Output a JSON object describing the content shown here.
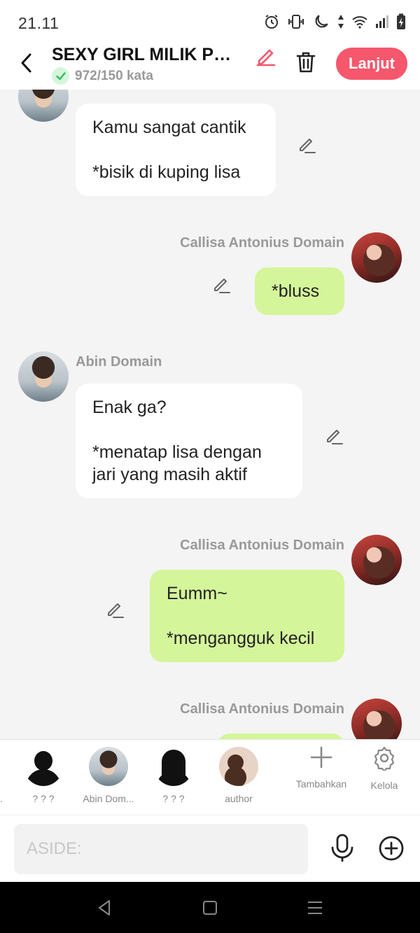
{
  "status_bar": {
    "time": "21.11"
  },
  "header": {
    "title": "SEXY GIRL MILIK PRI...",
    "word_count": "972/150 kata",
    "next_label": "Lanjut"
  },
  "messages": [
    {
      "side": "left",
      "text": "Kamu sangat cantik\n\n*bisik di kuping lisa"
    },
    {
      "side": "right",
      "name": "Callisa Antonius Domain",
      "text": "*bluss"
    },
    {
      "side": "left",
      "name": "Abin Domain",
      "text": "Enak ga?\n\n*menatap lisa dengan\njari yang masih aktif"
    },
    {
      "side": "right",
      "name": "Callisa Antonius Domain",
      "text": "Eumm~\n\n*mengangguk kecil"
    },
    {
      "side": "right",
      "name": "Callisa Antonius Domain",
      "text": ""
    }
  ],
  "characters": [
    {
      "label": "? ? ?"
    },
    {
      "label": "Abin Dom..."
    },
    {
      "label": "? ? ?"
    },
    {
      "label": "author"
    }
  ],
  "actions": {
    "add_label": "Tambahkan",
    "manage_label": "Kelola"
  },
  "input": {
    "placeholder": "ASIDE:"
  },
  "icons": {
    "status": [
      "alarm-icon",
      "vibrate-icon",
      "moon-icon",
      "data-arrows-icon",
      "wifi-icon",
      "signal-icon",
      "battery-charging-icon"
    ],
    "header": [
      "back-arrow-icon",
      "pencil-icon",
      "trash-icon",
      "check-icon"
    ],
    "input": [
      "microphone-icon",
      "plus-circle-icon"
    ],
    "nav": [
      "nav-back-icon",
      "nav-home-icon",
      "nav-menu-icon"
    ]
  },
  "colors": {
    "accent": "#f5576c",
    "my_bubble": "#d5f59a",
    "other_bubble": "#ffffff",
    "background": "#f4f4f4"
  }
}
